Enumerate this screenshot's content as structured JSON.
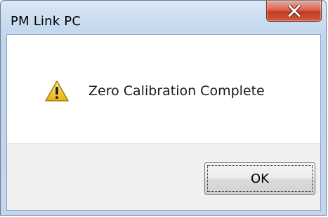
{
  "window": {
    "title": "PM Link PC"
  },
  "titlebar": {
    "close_icon": "close-icon"
  },
  "message": {
    "icon": "warning-icon",
    "text": "Zero Calibration Complete"
  },
  "buttons": {
    "ok_label": "OK"
  },
  "colors": {
    "close_button": "#c43a22",
    "warning_fill": "#f2c21b",
    "titlebar": "#c9dcf0"
  }
}
